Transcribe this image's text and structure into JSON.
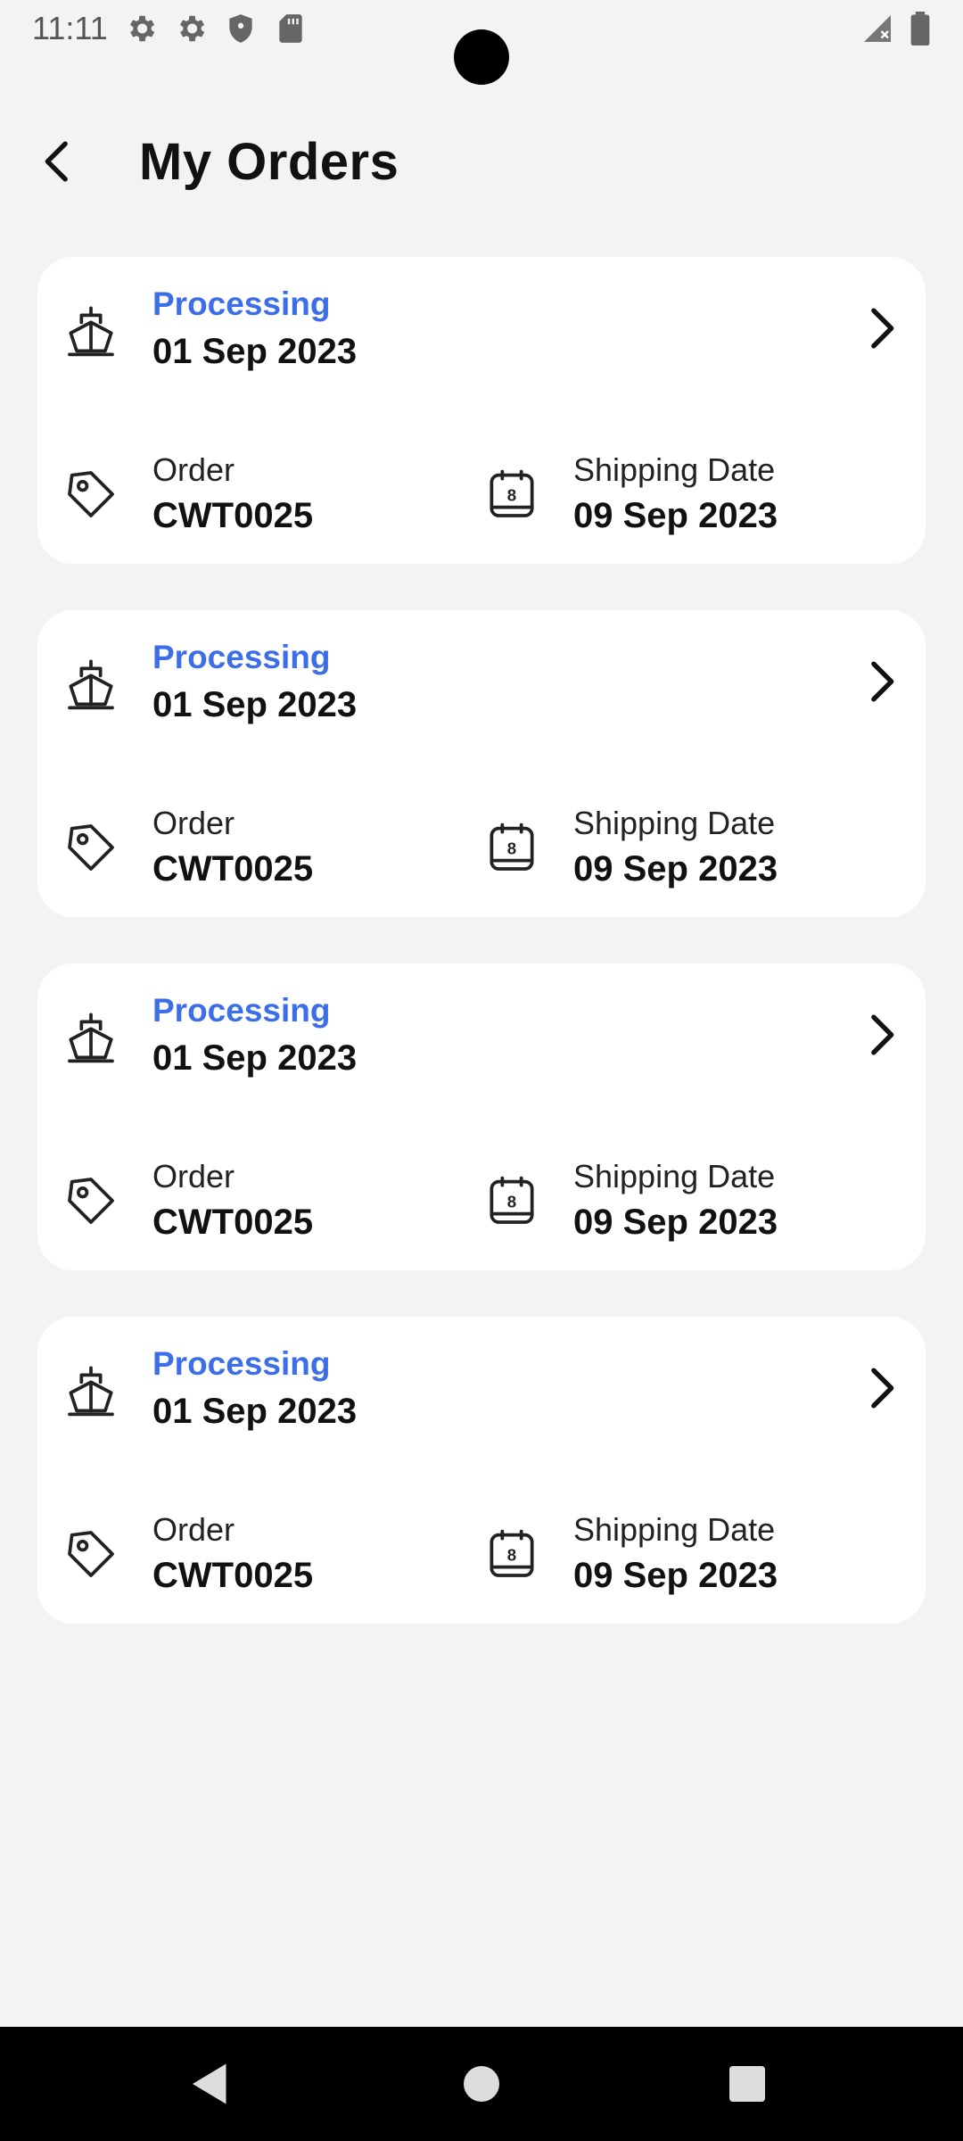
{
  "status_bar": {
    "time": "11:11",
    "icons": [
      "settings-icon",
      "settings-icon",
      "shield-icon",
      "sd-card-icon"
    ],
    "right_icons": [
      "signal-icon",
      "battery-icon"
    ]
  },
  "header": {
    "title": "My Orders",
    "back_icon": "back-arrow-icon"
  },
  "orders": [
    {
      "status": "Processing",
      "date": "01 Sep 2023",
      "order_label": "Order",
      "order_id": "CWT0025",
      "shipping_label": "Shipping Date",
      "shipping_date": "09 Sep 2023"
    },
    {
      "status": "Processing",
      "date": "01 Sep 2023",
      "order_label": "Order",
      "order_id": "CWT0025",
      "shipping_label": "Shipping Date",
      "shipping_date": "09 Sep 2023"
    },
    {
      "status": "Processing",
      "date": "01 Sep 2023",
      "order_label": "Order",
      "order_id": "CWT0025",
      "shipping_label": "Shipping Date",
      "shipping_date": "09 Sep 2023"
    },
    {
      "status": "Processing",
      "date": "01 Sep 2023",
      "order_label": "Order",
      "order_id": "CWT0025",
      "shipping_label": "Shipping Date",
      "shipping_date": "09 Sep 2023"
    }
  ],
  "calendar_icon_day": "8",
  "colors": {
    "background": "#f3f3f4",
    "card": "#ffffff",
    "status_accent": "#3b6ee8",
    "nav_bar": "#000000"
  },
  "nav_bar": {
    "buttons": [
      "back-triangle-icon",
      "home-circle-icon",
      "recents-square-icon"
    ]
  }
}
